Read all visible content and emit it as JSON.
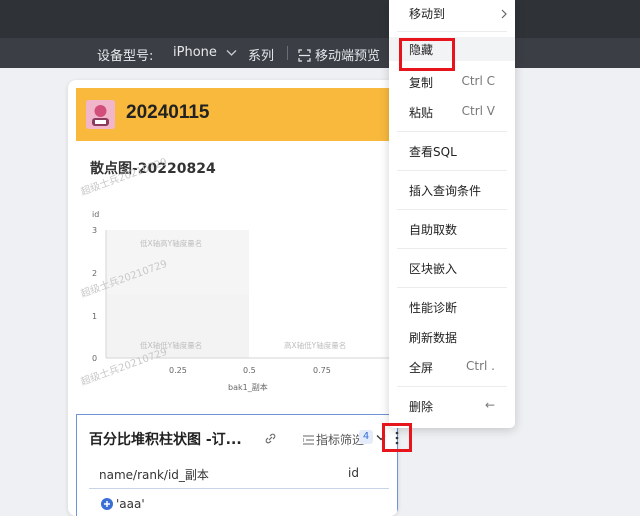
{
  "toolbar": {
    "device_label": "设备型号:",
    "device_value": "iPhone",
    "series_label": "系列",
    "preview_label": "移动端预览"
  },
  "dashboard": {
    "title": "20240115",
    "watermark": "超级士兵20210729"
  },
  "scatter_card": {
    "title": "散点图-20220824",
    "y_axis_label": "id",
    "y_ticks": [
      "0",
      "1",
      "2",
      "3"
    ],
    "x_ticks": [
      "0.25",
      "0.5",
      "0.75"
    ],
    "x_axis_label": "bak1_副本",
    "quadrant_labels": {
      "top_left": "低X轴高Y轴度量名",
      "bottom_left": "低X轴低Y轴度量名",
      "bottom_right": "高X轴低Y轴度量名"
    }
  },
  "bar_card": {
    "title": "百分比堆积柱状图 -订...",
    "filter_label": "指标筛选",
    "filter_count": "4",
    "col_header_left": "name/rank/id_副本",
    "col_header_right": "id",
    "first_row": "'aaa'"
  },
  "context_menu": {
    "move_to": "移动到",
    "hide": "隐藏",
    "copy": "复制",
    "copy_shortcut": "Ctrl C",
    "paste": "粘贴",
    "paste_shortcut": "Ctrl V",
    "view_sql": "查看SQL",
    "insert_query": "插入查询条件",
    "self_service": "自助取数",
    "embed_block": "区块嵌入",
    "perf_diag": "性能诊断",
    "refresh": "刷新数据",
    "fullscreen": "全屏",
    "fullscreen_shortcut": "Ctrl .",
    "delete": "删除",
    "delete_shortcut": "←"
  }
}
